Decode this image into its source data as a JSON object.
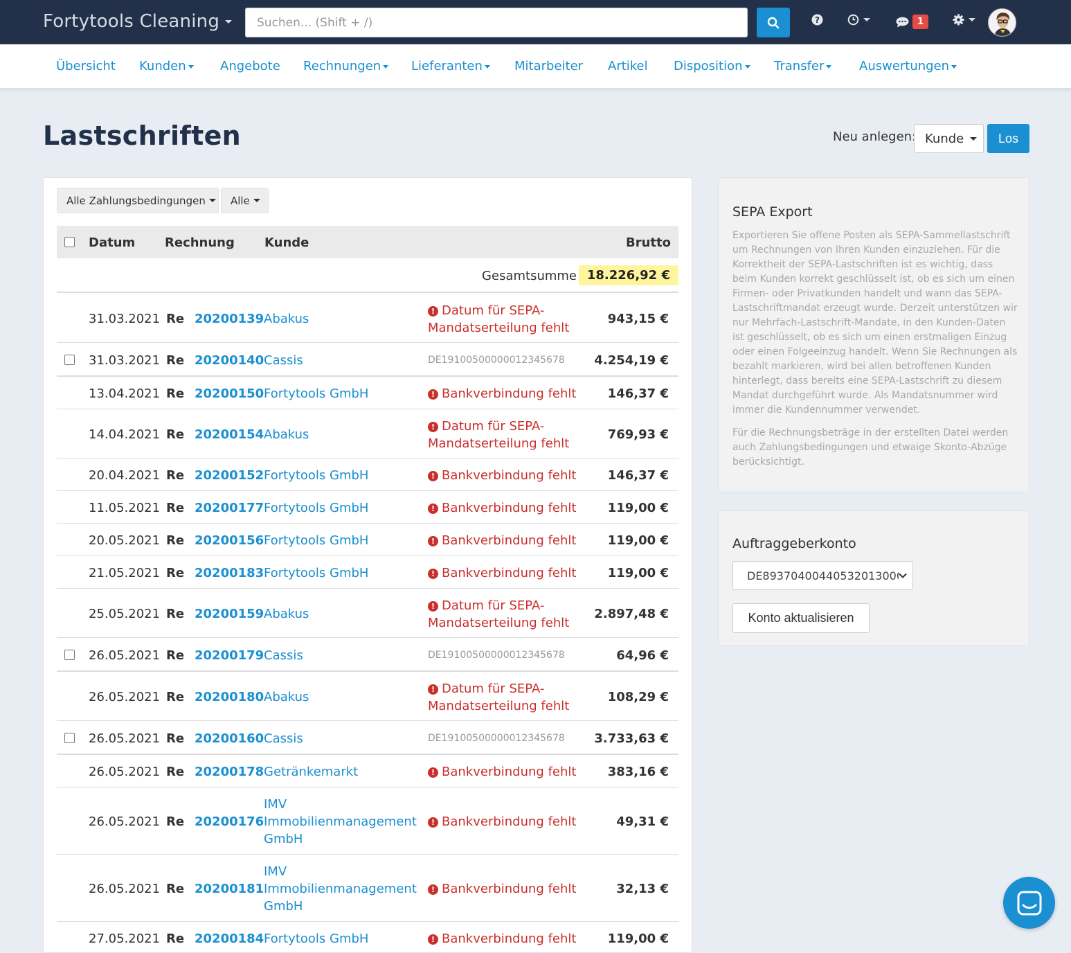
{
  "header": {
    "brand": "Fortytools Cleaning",
    "search_placeholder": "Suchen... (Shift + /)",
    "notification_count": "1"
  },
  "nav": [
    {
      "label": "Übersicht",
      "dropdown": false
    },
    {
      "label": "Kunden",
      "dropdown": true
    },
    {
      "label": "Angebote",
      "dropdown": false
    },
    {
      "label": "Rechnungen",
      "dropdown": true
    },
    {
      "label": "Lieferanten",
      "dropdown": true
    },
    {
      "label": "Mitarbeiter",
      "dropdown": false
    },
    {
      "label": "Artikel",
      "dropdown": false
    },
    {
      "label": "Disposition",
      "dropdown": true
    },
    {
      "label": "Transfer",
      "dropdown": true
    },
    {
      "label": "Auswertungen",
      "dropdown": true
    }
  ],
  "page": {
    "title": "Lastschriften",
    "new_label": "Neu anlegen:",
    "new_selected": "Kunde",
    "go_label": "Los"
  },
  "filters": {
    "terms": "Alle Zahlungsbedingungen",
    "scope": "Alle"
  },
  "table": {
    "headers": {
      "date": "Datum",
      "invoice": "Rechnung",
      "customer": "Kunde",
      "gross": "Brutto"
    },
    "total_label": "Gesamtsumme",
    "total_value": "18.226,92 €",
    "rows": [
      {
        "date": "31.03.2021",
        "prefix": "Re",
        "number": "20200139",
        "customer": "Abakus",
        "status": "Datum für SEPA-Mandatserteilung fehlt",
        "iban": "",
        "amount": "943,15 €",
        "checkbox": false
      },
      {
        "date": "31.03.2021",
        "prefix": "Re",
        "number": "20200140",
        "customer": "Cassis",
        "status": "",
        "iban": "DE19100500000012345678",
        "amount": "4.254,19 €",
        "checkbox": true
      },
      {
        "date": "13.04.2021",
        "prefix": "Re",
        "number": "20200150",
        "customer": "Fortytools GmbH",
        "status": "Bankverbindung fehlt",
        "iban": "",
        "amount": "146,37 €",
        "checkbox": false
      },
      {
        "date": "14.04.2021",
        "prefix": "Re",
        "number": "20200154",
        "customer": "Abakus",
        "status": "Datum für SEPA-Mandatserteilung fehlt",
        "iban": "",
        "amount": "769,93 €",
        "checkbox": false
      },
      {
        "date": "20.04.2021",
        "prefix": "Re",
        "number": "20200152",
        "customer": "Fortytools GmbH",
        "status": "Bankverbindung fehlt",
        "iban": "",
        "amount": "146,37 €",
        "checkbox": false
      },
      {
        "date": "11.05.2021",
        "prefix": "Re",
        "number": "20200177",
        "customer": "Fortytools GmbH",
        "status": "Bankverbindung fehlt",
        "iban": "",
        "amount": "119,00 €",
        "checkbox": false
      },
      {
        "date": "20.05.2021",
        "prefix": "Re",
        "number": "20200156",
        "customer": "Fortytools GmbH",
        "status": "Bankverbindung fehlt",
        "iban": "",
        "amount": "119,00 €",
        "checkbox": false
      },
      {
        "date": "21.05.2021",
        "prefix": "Re",
        "number": "20200183",
        "customer": "Fortytools GmbH",
        "status": "Bankverbindung fehlt",
        "iban": "",
        "amount": "119,00 €",
        "checkbox": false
      },
      {
        "date": "25.05.2021",
        "prefix": "Re",
        "number": "20200159",
        "customer": "Abakus",
        "status": "Datum für SEPA-Mandatserteilung fehlt",
        "iban": "",
        "amount": "2.897,48 €",
        "checkbox": false
      },
      {
        "date": "26.05.2021",
        "prefix": "Re",
        "number": "20200179",
        "customer": "Cassis",
        "status": "",
        "iban": "DE19100500000012345678",
        "amount": "64,96 €",
        "checkbox": true
      },
      {
        "date": "26.05.2021",
        "prefix": "Re",
        "number": "20200180",
        "customer": "Abakus",
        "status": "Datum für SEPA-Mandatserteilung fehlt",
        "iban": "",
        "amount": "108,29 €",
        "checkbox": false
      },
      {
        "date": "26.05.2021",
        "prefix": "Re",
        "number": "20200160",
        "customer": "Cassis",
        "status": "",
        "iban": "DE19100500000012345678",
        "amount": "3.733,63 €",
        "checkbox": true
      },
      {
        "date": "26.05.2021",
        "prefix": "Re",
        "number": "20200178",
        "customer": "Getränkemarkt",
        "status": "Bankverbindung fehlt",
        "iban": "",
        "amount": "383,16 €",
        "checkbox": false
      },
      {
        "date": "26.05.2021",
        "prefix": "Re",
        "number": "20200176",
        "customer": "IMV Immobilienmanagement GmbH",
        "status": "Bankverbindung fehlt",
        "iban": "",
        "amount": "49,31 €",
        "checkbox": false
      },
      {
        "date": "26.05.2021",
        "prefix": "Re",
        "number": "20200181",
        "customer": "IMV Immobilienmanagement GmbH",
        "status": "Bankverbindung fehlt",
        "iban": "",
        "amount": "32,13 €",
        "checkbox": false
      },
      {
        "date": "27.05.2021",
        "prefix": "Re",
        "number": "20200184",
        "customer": "Fortytools GmbH",
        "status": "Bankverbindung fehlt",
        "iban": "",
        "amount": "119,00 €",
        "checkbox": false
      }
    ]
  },
  "sepa": {
    "title": "SEPA Export",
    "para1": "Exportieren Sie offene Posten als SEPA-Sammellastschrift um Rechnungen von Ihren Kunden einzuziehen. Für die Korrektheit der SEPA-Lastschriften ist es wichtig, dass beim Kunden korrekt geschlüsselt ist, ob es sich um einen Firmen- oder Privatkunden handelt und wann das SEPA-Lastschriftmandat erzeugt wurde. Derzeit unterstützen wir nur Mehrfach-Lastschrift-Mandate, in den Kunden-Daten ist geschlüsselt, ob es sich um einen erstmaligen Einzug oder einen Folgeeinzug handelt. Wenn Sie Rechnungen als bezahlt markieren, wird bei allen betroffenen Kunden hinterlegt, dass bereits eine SEPA-Lastschrift zu diesem Mandat durchgeführt wurde. Als Mandatsnummer wird immer die Kundennummer verwendet.",
    "para2": "Für die Rechnungsbeträge in der erstellten Datei werden auch Zahlungsbedingungen und etwaige Skonto-Abzüge berücksichtigt."
  },
  "account": {
    "title": "Auftraggeberkonto",
    "selected": "DE89370400440532013000",
    "update_label": "Konto aktualisieren"
  },
  "colors": {
    "topbar": "#22304a",
    "accent": "#1a8fd1",
    "error": "#c9302c",
    "highlight": "#fff59d"
  }
}
